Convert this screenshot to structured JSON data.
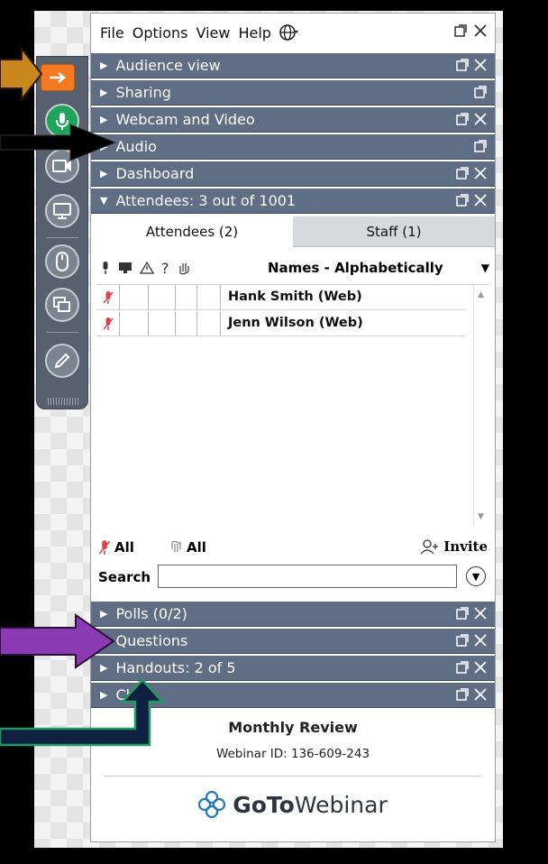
{
  "menu": {
    "items": [
      "File",
      "Options",
      "View",
      "Help"
    ],
    "language_icon": "globe-icon"
  },
  "sections": [
    {
      "label": "Audience view",
      "expanded": false
    },
    {
      "label": "Sharing",
      "expanded": false
    },
    {
      "label": "Webcam and Video",
      "expanded": false
    },
    {
      "label": "Audio",
      "expanded": false
    },
    {
      "label": "Dashboard",
      "expanded": false
    },
    {
      "label": "Attendees: 3 out of 1001",
      "expanded": true
    }
  ],
  "attendees": {
    "tabs": [
      {
        "label": "Attendees (2)",
        "active": true
      },
      {
        "label": "Staff (1)",
        "active": false
      }
    ],
    "sort_label": "Names - Alphabetically",
    "rows": [
      {
        "name": "Hank Smith (Web)"
      },
      {
        "name": "Jenn Wilson (Web)"
      }
    ],
    "mute_all_label": "All",
    "lower_hands_label": "All",
    "invite_label": "Invite",
    "search_label": "Search",
    "search_value": ""
  },
  "lower_sections": [
    {
      "label": "Polls (0/2)"
    },
    {
      "label": "Questions"
    },
    {
      "label": "Handouts: 2 of 5"
    },
    {
      "label": "Chat"
    }
  ],
  "footer": {
    "webinar_title": "Monthly Review",
    "webinar_id": "Webinar ID: 136-609-243",
    "brand_bold": "GoTo",
    "brand_light": "Webinar"
  },
  "colors": {
    "section_bar": "#5f6d85",
    "toolbar": "#56606e",
    "accent_orange": "#f47920",
    "mic_green": "#1fa55a",
    "arrow_gold": "#c9861c",
    "arrow_purple": "#8a3ab3",
    "arrow_navy": "#0f2040"
  }
}
